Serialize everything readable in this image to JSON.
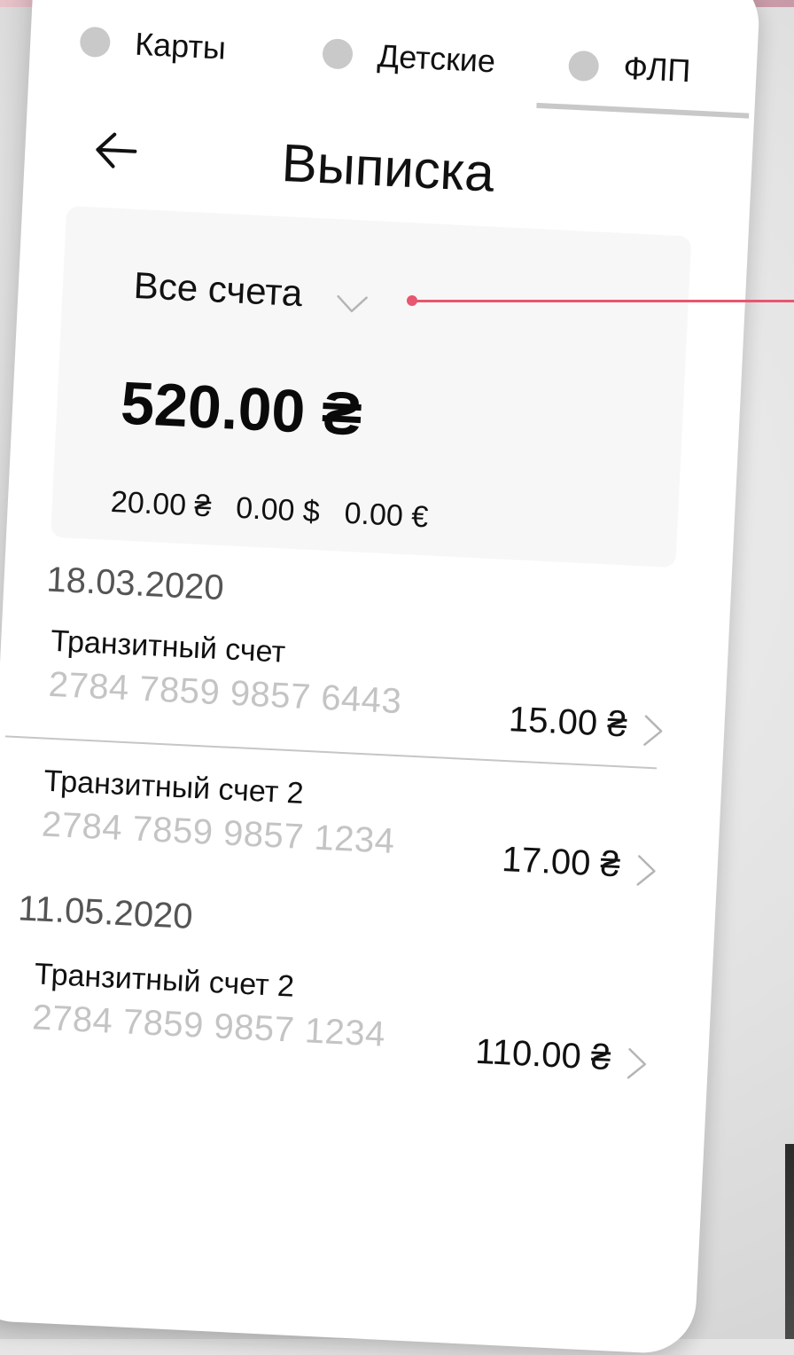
{
  "tabs": [
    {
      "label": "Карты"
    },
    {
      "label": "Детские"
    },
    {
      "label": "ФЛП"
    }
  ],
  "header": {
    "title": "Выписка",
    "back_icon": "arrow-left-icon"
  },
  "summary": {
    "account_filter": "Все счета",
    "total": "520.00 ₴",
    "currencies": [
      "20.00 ₴",
      "0.00 $",
      "0.00 €"
    ]
  },
  "groups": [
    {
      "date": "18.03.2020",
      "items": [
        {
          "name": "Транзитный счет",
          "number": "2784 7859 9857 6443",
          "amount": "15.00 ₴"
        },
        {
          "name": "Транзитный счет 2",
          "number": "2784 7859 9857 1234",
          "amount": "17.00 ₴"
        }
      ]
    },
    {
      "date": "11.05.2020",
      "items": [
        {
          "name": "Транзитный счет 2",
          "number": "2784 7859 9857 1234",
          "amount": "110.00 ₴"
        }
      ]
    }
  ],
  "colors": {
    "accent": "#e8566f",
    "inactive_dot": "#c9c9c9",
    "muted_text": "#c4c4c4"
  }
}
